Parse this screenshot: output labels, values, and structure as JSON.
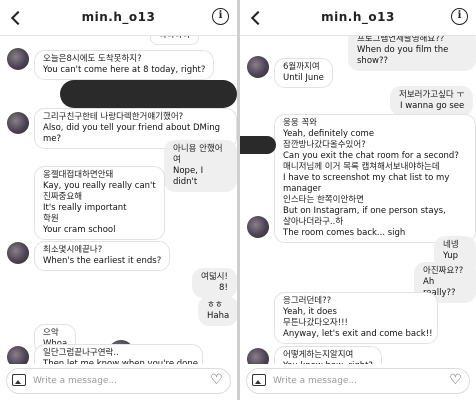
{
  "header": {
    "title": "min.h_o13"
  },
  "composer": {
    "placeholder": "Write a message..."
  },
  "left": {
    "top_partial": "ㅋㅋㅋㅋ",
    "m1_ko": "오늘은8시에도 도착못하지?",
    "m1_en": "You can't come here at 8 today, right?",
    "m2_ko": "그리구친구한테 나랑다렉한거얘기했어?",
    "m2_en": "Also, did you tell your friend about DMing me?",
    "m3_ko": "아니용 안했어여",
    "m3_en": "Nope, I didn't",
    "m4_ko1": "옹젤대접대하면안돼",
    "m4_en1": "Kay, you really really can't",
    "m4_ko2": "진짜중요해",
    "m4_en2": "It's really important",
    "m4_ko3": "학원",
    "m4_en3": "Your cram school",
    "m5_ko": "최소몇시에끝나?",
    "m5_en": "When's the earliest it ends?",
    "m6_ko": "여덟시!",
    "m6_en": "8!",
    "m7_ko": "ㅎㅎ",
    "m7_en": "Haha",
    "m8_ko": "으악",
    "m8_en": "Whoa",
    "m9_ko": "일단그럼끝나구연락..",
    "m9_en": "Then let me know when you're done"
  },
  "right": {
    "r0_ko": "프로그램언제촬영해요??",
    "r0_en": "When do you film the show??",
    "r1_ko": "6월까지여",
    "r1_en": "Until June",
    "r2_ko": "저보러가고싶다 ㅜ",
    "r2_en": "I wanna go see",
    "r3_ko": "웅웅 꼭와",
    "r3_en": "Yeah, definitely come",
    "r3_ko2": "잠깐방나갔다올수있어?",
    "r3_en2": "Can you exit the chat room for a second?",
    "r3_ko3": "매니저님께 이거 목록 캡쳐해서보내야하는데",
    "r3_en3": "I have to screenshot my chat list to my manager",
    "r3_ko4": "인스타는 한쪽이안하면",
    "r3_en4": "But on Instagram, if one person stays,",
    "r3_ko5": "살아나더라구..하",
    "r3_en5": "The room comes back... sigh",
    "r4_ko": "네넹",
    "r4_en": "Yup yup",
    "r5_ko": "아진짜요??",
    "r5_en": "Ah really??",
    "r6_ko": "응그러던데??",
    "r6_en": "Yeah, it does",
    "r7_ko": "무튼나갔다오자!!!",
    "r7_en": "Anyway, let's exit and come back!!",
    "r8_ko": "어떻게하는지알지여",
    "r8_en": "You know how, right?"
  }
}
